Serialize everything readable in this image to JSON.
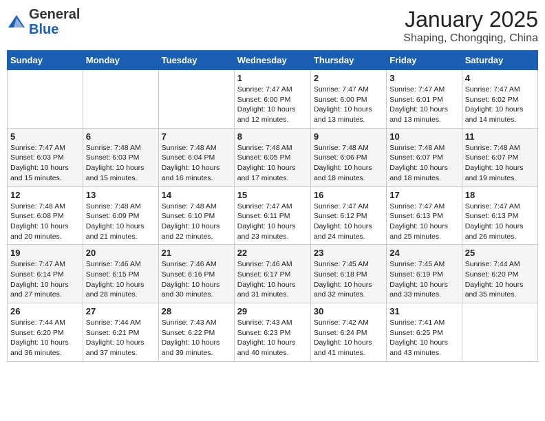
{
  "header": {
    "logo_general": "General",
    "logo_blue": "Blue",
    "month_title": "January 2025",
    "location": "Shaping, Chongqing, China"
  },
  "days_of_week": [
    "Sunday",
    "Monday",
    "Tuesday",
    "Wednesday",
    "Thursday",
    "Friday",
    "Saturday"
  ],
  "weeks": [
    [
      {
        "day": "",
        "sunrise": "",
        "sunset": "",
        "daylight": ""
      },
      {
        "day": "",
        "sunrise": "",
        "sunset": "",
        "daylight": ""
      },
      {
        "day": "",
        "sunrise": "",
        "sunset": "",
        "daylight": ""
      },
      {
        "day": "1",
        "sunrise": "7:47 AM",
        "sunset": "6:00 PM",
        "daylight": "10 hours and 12 minutes."
      },
      {
        "day": "2",
        "sunrise": "7:47 AM",
        "sunset": "6:00 PM",
        "daylight": "10 hours and 13 minutes."
      },
      {
        "day": "3",
        "sunrise": "7:47 AM",
        "sunset": "6:01 PM",
        "daylight": "10 hours and 13 minutes."
      },
      {
        "day": "4",
        "sunrise": "7:47 AM",
        "sunset": "6:02 PM",
        "daylight": "10 hours and 14 minutes."
      }
    ],
    [
      {
        "day": "5",
        "sunrise": "7:47 AM",
        "sunset": "6:03 PM",
        "daylight": "10 hours and 15 minutes."
      },
      {
        "day": "6",
        "sunrise": "7:48 AM",
        "sunset": "6:03 PM",
        "daylight": "10 hours and 15 minutes."
      },
      {
        "day": "7",
        "sunrise": "7:48 AM",
        "sunset": "6:04 PM",
        "daylight": "10 hours and 16 minutes."
      },
      {
        "day": "8",
        "sunrise": "7:48 AM",
        "sunset": "6:05 PM",
        "daylight": "10 hours and 17 minutes."
      },
      {
        "day": "9",
        "sunrise": "7:48 AM",
        "sunset": "6:06 PM",
        "daylight": "10 hours and 18 minutes."
      },
      {
        "day": "10",
        "sunrise": "7:48 AM",
        "sunset": "6:07 PM",
        "daylight": "10 hours and 18 minutes."
      },
      {
        "day": "11",
        "sunrise": "7:48 AM",
        "sunset": "6:07 PM",
        "daylight": "10 hours and 19 minutes."
      }
    ],
    [
      {
        "day": "12",
        "sunrise": "7:48 AM",
        "sunset": "6:08 PM",
        "daylight": "10 hours and 20 minutes."
      },
      {
        "day": "13",
        "sunrise": "7:48 AM",
        "sunset": "6:09 PM",
        "daylight": "10 hours and 21 minutes."
      },
      {
        "day": "14",
        "sunrise": "7:48 AM",
        "sunset": "6:10 PM",
        "daylight": "10 hours and 22 minutes."
      },
      {
        "day": "15",
        "sunrise": "7:47 AM",
        "sunset": "6:11 PM",
        "daylight": "10 hours and 23 minutes."
      },
      {
        "day": "16",
        "sunrise": "7:47 AM",
        "sunset": "6:12 PM",
        "daylight": "10 hours and 24 minutes."
      },
      {
        "day": "17",
        "sunrise": "7:47 AM",
        "sunset": "6:13 PM",
        "daylight": "10 hours and 25 minutes."
      },
      {
        "day": "18",
        "sunrise": "7:47 AM",
        "sunset": "6:13 PM",
        "daylight": "10 hours and 26 minutes."
      }
    ],
    [
      {
        "day": "19",
        "sunrise": "7:47 AM",
        "sunset": "6:14 PM",
        "daylight": "10 hours and 27 minutes."
      },
      {
        "day": "20",
        "sunrise": "7:46 AM",
        "sunset": "6:15 PM",
        "daylight": "10 hours and 28 minutes."
      },
      {
        "day": "21",
        "sunrise": "7:46 AM",
        "sunset": "6:16 PM",
        "daylight": "10 hours and 30 minutes."
      },
      {
        "day": "22",
        "sunrise": "7:46 AM",
        "sunset": "6:17 PM",
        "daylight": "10 hours and 31 minutes."
      },
      {
        "day": "23",
        "sunrise": "7:45 AM",
        "sunset": "6:18 PM",
        "daylight": "10 hours and 32 minutes."
      },
      {
        "day": "24",
        "sunrise": "7:45 AM",
        "sunset": "6:19 PM",
        "daylight": "10 hours and 33 minutes."
      },
      {
        "day": "25",
        "sunrise": "7:44 AM",
        "sunset": "6:20 PM",
        "daylight": "10 hours and 35 minutes."
      }
    ],
    [
      {
        "day": "26",
        "sunrise": "7:44 AM",
        "sunset": "6:20 PM",
        "daylight": "10 hours and 36 minutes."
      },
      {
        "day": "27",
        "sunrise": "7:44 AM",
        "sunset": "6:21 PM",
        "daylight": "10 hours and 37 minutes."
      },
      {
        "day": "28",
        "sunrise": "7:43 AM",
        "sunset": "6:22 PM",
        "daylight": "10 hours and 39 minutes."
      },
      {
        "day": "29",
        "sunrise": "7:43 AM",
        "sunset": "6:23 PM",
        "daylight": "10 hours and 40 minutes."
      },
      {
        "day": "30",
        "sunrise": "7:42 AM",
        "sunset": "6:24 PM",
        "daylight": "10 hours and 41 minutes."
      },
      {
        "day": "31",
        "sunrise": "7:41 AM",
        "sunset": "6:25 PM",
        "daylight": "10 hours and 43 minutes."
      },
      {
        "day": "",
        "sunrise": "",
        "sunset": "",
        "daylight": ""
      }
    ]
  ],
  "labels": {
    "sunrise_prefix": "Sunrise: ",
    "sunset_prefix": "Sunset: ",
    "daylight_prefix": "Daylight: "
  }
}
